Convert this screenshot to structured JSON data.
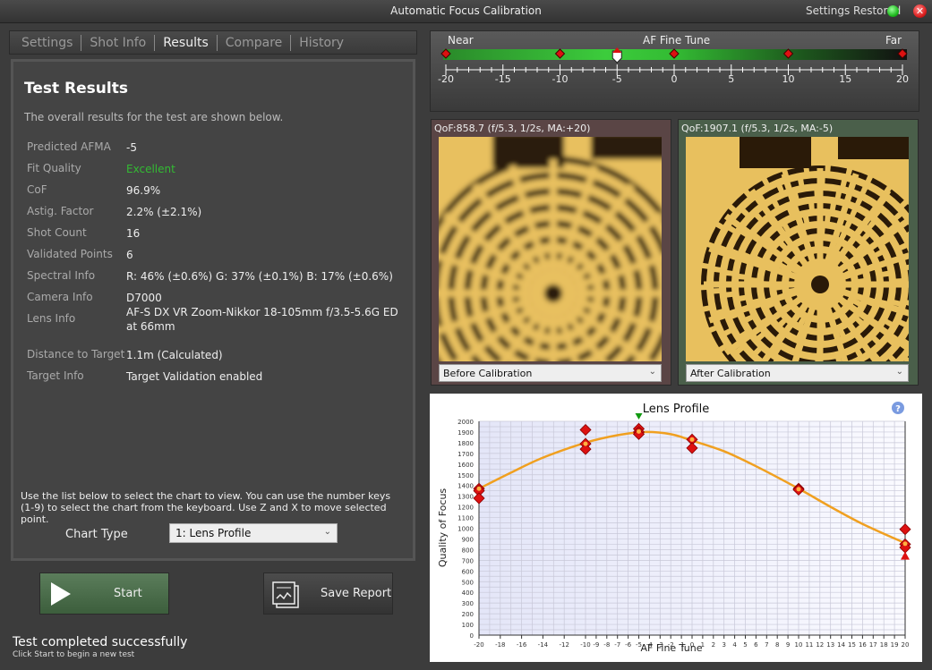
{
  "window": {
    "title": "Automatic Focus Calibration",
    "status": "Settings Restored",
    "status_color": "#22bb22",
    "close_icon": "close-icon"
  },
  "tabs": [
    {
      "label": "Settings"
    },
    {
      "label": "Shot Info"
    },
    {
      "label": "Results",
      "active": true
    },
    {
      "label": "Compare"
    },
    {
      "label": "History"
    }
  ],
  "results": {
    "title": "Test Results",
    "subtitle": "The overall results for the test are shown below.",
    "rows": [
      {
        "label": "Predicted AFMA",
        "value": "-5"
      },
      {
        "label": "Fit Quality",
        "value": "Excellent",
        "color": "#33bb33"
      },
      {
        "label": "CoF",
        "value": "96.9%"
      },
      {
        "label": "Astig. Factor",
        "value": "2.2% (±2.1%)"
      },
      {
        "label": "Shot Count",
        "value": "16"
      },
      {
        "label": "Validated Points",
        "value": "6"
      },
      {
        "label": "Spectral Info",
        "value": "R: 46% (±0.6%) G: 37% (±0.1%) B: 17% (±0.6%)"
      },
      {
        "label": "Camera Info",
        "value": "D7000"
      },
      {
        "label": "Lens Info",
        "value": "AF-S DX VR Zoom-Nikkor 18-105mm f/3.5-5.6G ED at 66mm"
      },
      {
        "label": "Distance to Target",
        "value": "1.1m (Calculated)"
      },
      {
        "label": "Target Info",
        "value": "Target Validation enabled"
      }
    ],
    "help": "Use the list below to select the chart to view.  You can use the number keys (1-9) to select the chart from the keyboard.  Use Z and X to move selected point.",
    "chart_type_label": "Chart Type",
    "chart_type_value": "1: Lens Profile"
  },
  "buttons": {
    "start": "Start",
    "save_report": "Save Report"
  },
  "status": {
    "main": "Test completed successfully",
    "sub": "Click Start to begin a new test"
  },
  "slider": {
    "near": "Near",
    "title": "AF Fine Tune",
    "far": "Far",
    "min": -20,
    "max": 20,
    "value": -5,
    "tick_labels": [
      "-20",
      "-15",
      "-10",
      "-5",
      "0",
      "5",
      "10",
      "15",
      "20"
    ],
    "markers": [
      -20,
      -10,
      -5,
      0,
      10,
      20
    ]
  },
  "images": {
    "before": {
      "caption": "QoF:858.7 (f/5.3, 1/2s, MA:+20)",
      "select": "Before Calibration",
      "panel_color": "#5a4545"
    },
    "after": {
      "caption": "QoF:1907.1 (f/5.3, 1/2s, MA:-5)",
      "select": "After Calibration",
      "panel_color": "#4a5f4a"
    }
  },
  "chart_data": {
    "type": "scatter",
    "title": "Lens Profile",
    "xlabel": "AF Fine Tune",
    "ylabel": "Quality of Focus",
    "xlim": [
      -20,
      20
    ],
    "ylim": [
      0,
      2000
    ],
    "grid": true,
    "x_tick_labels": [
      "-20",
      "-18",
      "-16",
      "-14",
      "-12",
      "-10",
      "-9",
      "-8",
      "-7",
      "-6",
      "-5",
      "-4",
      "-3",
      "-2",
      "-1",
      "0",
      "1",
      "2",
      "3",
      "4",
      "5",
      "6",
      "7",
      "8",
      "9",
      "10",
      "11",
      "12",
      "13",
      "14",
      "15",
      "16",
      "17",
      "18",
      "19",
      "20"
    ],
    "y_tick_labels": [
      "0",
      "100",
      "200",
      "300",
      "400",
      "500",
      "600",
      "700",
      "800",
      "900",
      "1000",
      "1100",
      "1200",
      "1300",
      "1400",
      "1500",
      "1600",
      "1700",
      "1800",
      "1900",
      "2000"
    ],
    "points": [
      {
        "x": -20,
        "y": 1370
      },
      {
        "x": -20,
        "y": 1350
      },
      {
        "x": -20,
        "y": 1280
      },
      {
        "x": -10,
        "y": 1920
      },
      {
        "x": -10,
        "y": 1790
      },
      {
        "x": -10,
        "y": 1740
      },
      {
        "x": -5,
        "y": 1930
      },
      {
        "x": -5,
        "y": 1900
      },
      {
        "x": -5,
        "y": 1880
      },
      {
        "x": 0,
        "y": 1830
      },
      {
        "x": 0,
        "y": 1750
      },
      {
        "x": 10,
        "y": 1370
      },
      {
        "x": 10,
        "y": 1360
      },
      {
        "x": 20,
        "y": 990
      },
      {
        "x": 20,
        "y": 850
      },
      {
        "x": 20,
        "y": 820
      },
      {
        "x": 20,
        "y": 740,
        "marker": "triangle"
      }
    ],
    "means": [
      {
        "x": -20,
        "y": 1370
      },
      {
        "x": -10,
        "y": 1790
      },
      {
        "x": -5,
        "y": 1905
      },
      {
        "x": 0,
        "y": 1830
      },
      {
        "x": 10,
        "y": 1365
      },
      {
        "x": 20,
        "y": 855
      }
    ],
    "fit_curve": [
      {
        "x": -20,
        "y": 1370
      },
      {
        "x": -17,
        "y": 1520
      },
      {
        "x": -14,
        "y": 1660
      },
      {
        "x": -10,
        "y": 1800
      },
      {
        "x": -7,
        "y": 1870
      },
      {
        "x": -4.5,
        "y": 1900
      },
      {
        "x": -2,
        "y": 1880
      },
      {
        "x": 0,
        "y": 1820
      },
      {
        "x": 3,
        "y": 1720
      },
      {
        "x": 6,
        "y": 1580
      },
      {
        "x": 10,
        "y": 1370
      },
      {
        "x": 13,
        "y": 1200
      },
      {
        "x": 16,
        "y": 1040
      },
      {
        "x": 20,
        "y": 860
      }
    ],
    "optimum_marker_x": -5,
    "series_color": "#f0a020",
    "point_color": "#dd1111"
  }
}
